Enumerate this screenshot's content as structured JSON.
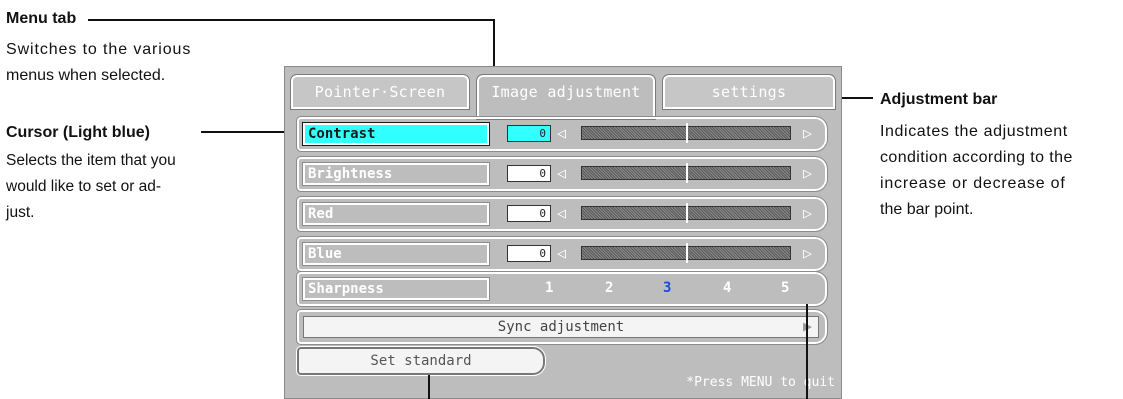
{
  "annotations": {
    "menu_tab": {
      "title": "Menu tab",
      "desc": [
        "Switches to the various",
        "menus when selected."
      ]
    },
    "cursor": {
      "title": "Cursor (Light blue)",
      "desc": [
        "Selects the item that you",
        "would like to set or ad-",
        "just."
      ]
    },
    "adjustment_bar": {
      "title": "Adjustment bar",
      "desc": [
        "Indicates the adjustment",
        "condition according to the",
        "increase or decrease of",
        "the bar point."
      ]
    }
  },
  "osd": {
    "tabs": [
      "Pointer·Screen",
      "Image adjustment",
      "settings"
    ],
    "rows": [
      {
        "label": "Contrast",
        "value": "0",
        "selected": true
      },
      {
        "label": "Brightness",
        "value": "0",
        "selected": false
      },
      {
        "label": "Red",
        "value": "0",
        "selected": false
      },
      {
        "label": "Blue",
        "value": "0",
        "selected": false
      }
    ],
    "sharpness": {
      "label": "Sharpness",
      "levels": [
        "1",
        "2",
        "3",
        "4",
        "5"
      ],
      "selected": "3"
    },
    "sync_label": "Sync adjustment",
    "set_standard": "Set standard",
    "hint": "*Press MENU to quit"
  },
  "icons": {
    "left_arrow": "triangle-left-icon",
    "right_arrow": "triangle-right-icon"
  },
  "colors": {
    "cursor": "#33ffff",
    "selected_level": "#1a4bd8",
    "panel": "#bdbdbd"
  }
}
